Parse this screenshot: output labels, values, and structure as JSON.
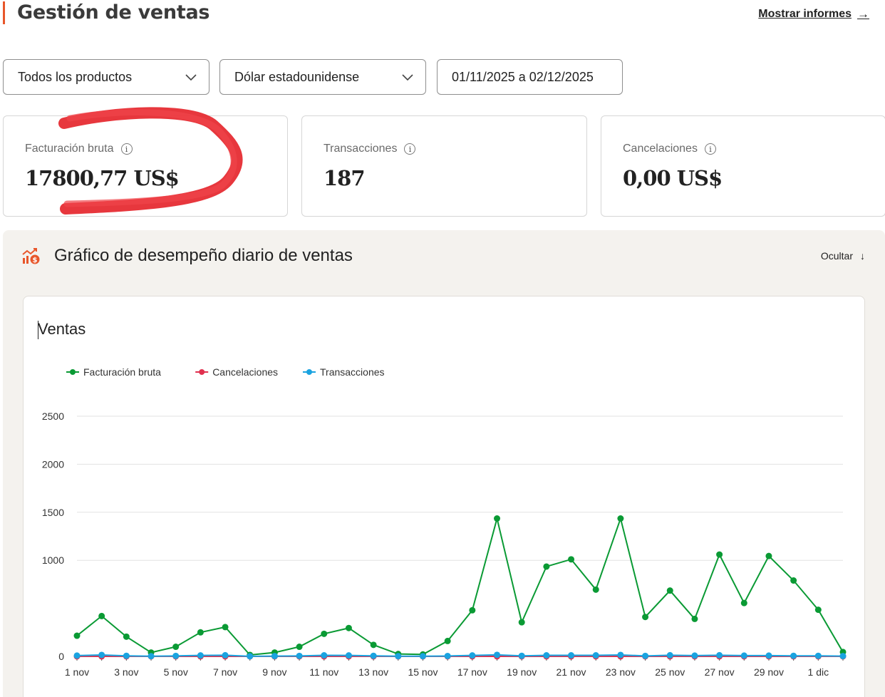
{
  "header": {
    "title": "Gestión de ventas",
    "reports_link": "Mostrar informes",
    "reports_arrow": "→"
  },
  "filters": {
    "products": "Todos los productos",
    "currency": "Dólar estadounidense",
    "date_range": "01/11/2025 a 02/12/2025"
  },
  "stats": {
    "revenue": {
      "label": "Facturación bruta",
      "value": "17800,77 US$"
    },
    "transactions": {
      "label": "Transacciones",
      "value": "187"
    },
    "cancellations": {
      "label": "Cancelaciones",
      "value": "0,00 US$"
    }
  },
  "performance": {
    "title": "Gráfico de desempeño diario de ventas",
    "hide_label": "Ocultar",
    "hide_arrow": "↓"
  },
  "chart_data": {
    "type": "line",
    "title": "Ventas",
    "legend_position": "top-left",
    "grid": true,
    "ylim": [
      0,
      2500
    ],
    "y_ticks": [
      "0",
      "1000",
      "1500",
      "2000",
      "2500"
    ],
    "x": [
      "1 nov",
      "2 nov",
      "3 nov",
      "4 nov",
      "5 nov",
      "6 nov",
      "7 nov",
      "8 nov",
      "9 nov",
      "10 nov",
      "11 nov",
      "12 nov",
      "13 nov",
      "14 nov",
      "15 nov",
      "16 nov",
      "17 nov",
      "18 nov",
      "19 nov",
      "20 nov",
      "21 nov",
      "22 nov",
      "23 nov",
      "24 nov",
      "25 nov",
      "26 nov",
      "27 nov",
      "28 nov",
      "29 nov",
      "30 nov",
      "1 dic",
      "2 dic"
    ],
    "x_tick_labels": [
      "1 nov",
      "3 nov",
      "5 nov",
      "7 nov",
      "9 nov",
      "11 nov",
      "13 nov",
      "15 nov",
      "17 nov",
      "19 nov",
      "21 nov",
      "23 nov",
      "25 nov",
      "27 nov",
      "29 nov",
      "1 dic"
    ],
    "series": [
      {
        "name": "Facturación bruta",
        "color": "#0a9a34",
        "values": [
          215,
          420,
          205,
          40,
          100,
          250,
          305,
          15,
          40,
          100,
          235,
          295,
          120,
          25,
          20,
          160,
          480,
          1435,
          355,
          935,
          1010,
          695,
          1435,
          410,
          685,
          390,
          1060,
          555,
          1045,
          790,
          485,
          45
        ]
      },
      {
        "name": "Cancelaciones",
        "color": "#e0304e",
        "values": [
          0,
          0,
          0,
          0,
          0,
          0,
          0,
          0,
          0,
          0,
          0,
          0,
          0,
          0,
          0,
          0,
          0,
          0,
          0,
          0,
          0,
          0,
          0,
          0,
          0,
          0,
          0,
          0,
          0,
          0,
          0,
          0
        ]
      },
      {
        "name": "Transacciones",
        "color": "#1aa3e0",
        "values": [
          8,
          15,
          6,
          2,
          5,
          10,
          12,
          1,
          3,
          5,
          11,
          10,
          6,
          2,
          2,
          4,
          10,
          16,
          6,
          11,
          11,
          11,
          15,
          5,
          12,
          8,
          12,
          8,
          8,
          6,
          6,
          3
        ]
      }
    ]
  }
}
